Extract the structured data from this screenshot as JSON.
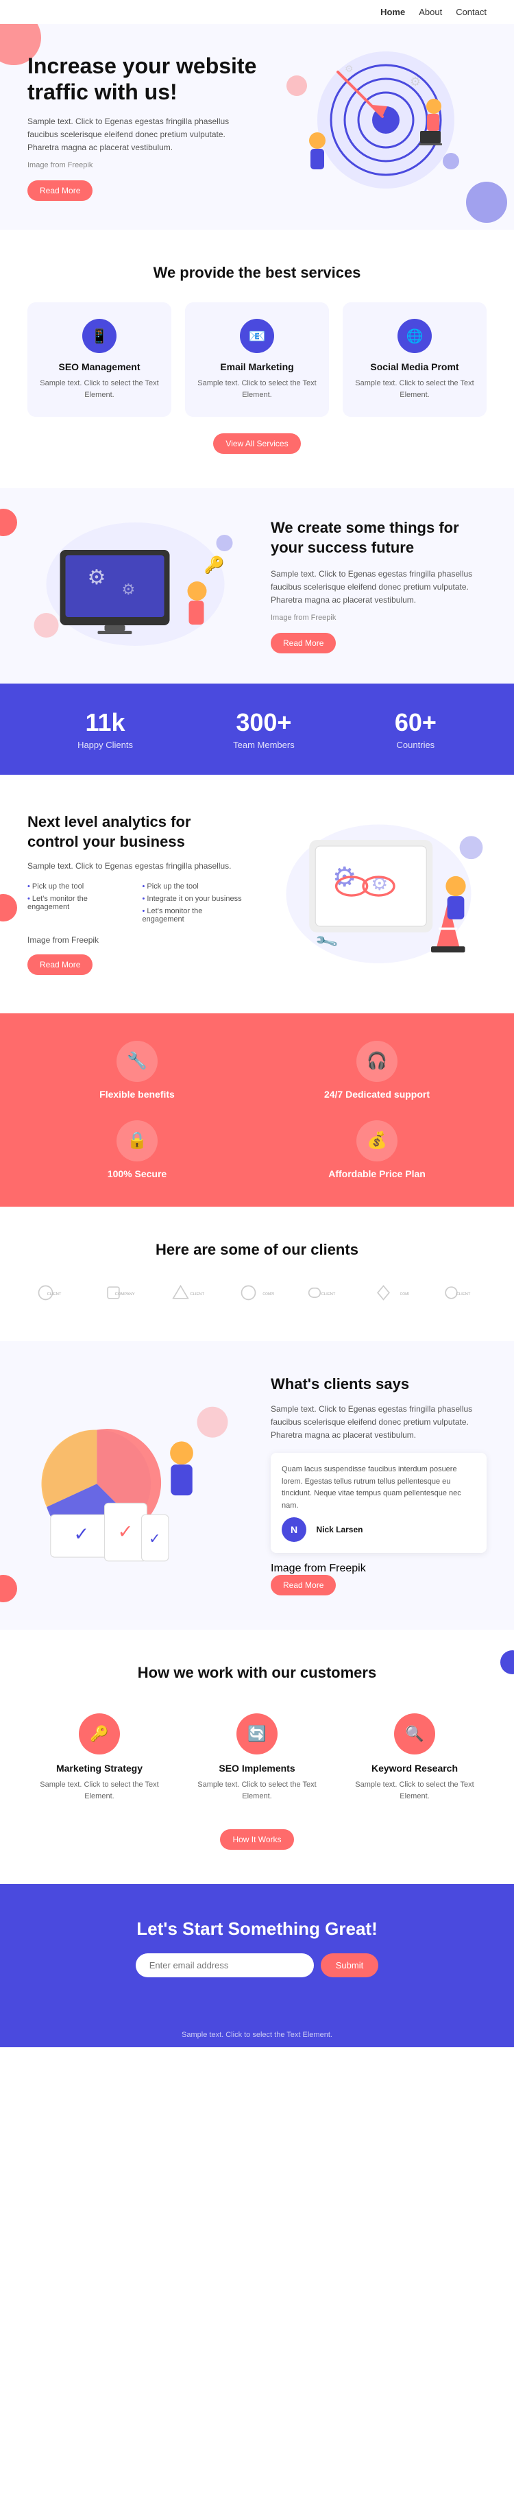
{
  "nav": {
    "links": [
      {
        "label": "Home",
        "active": true
      },
      {
        "label": "About",
        "active": false
      },
      {
        "label": "Contact",
        "active": false
      }
    ]
  },
  "hero": {
    "heading": "Increase your website traffic with us!",
    "body": "Sample text. Click to Egenas egestas fringilla phasellus faucibus scelerisque eleifend donec pretium vulputate. Pharetra magna ac placerat vestibulum.",
    "image_credit": "Image from Freepik",
    "cta_label": "Read More"
  },
  "services": {
    "heading": "We provide the best services",
    "cards": [
      {
        "icon": "📱",
        "title": "SEO Management",
        "body": "Sample text. Click to select the Text Element."
      },
      {
        "icon": "📧",
        "title": "Email Marketing",
        "body": "Sample text. Click to select the Text Element."
      },
      {
        "icon": "🌐",
        "title": "Social Media Promt",
        "body": "Sample text. Click to select the Text Element."
      }
    ],
    "view_all_label": "View All Services"
  },
  "create": {
    "heading": "We create some things for your success future",
    "body": "Sample text. Click to Egenas egestas fringilla phasellus faucibus scelerisque eleifend donec pretium vulputate. Pharetra magna ac placerat vestibulum.",
    "image_credit": "Image from Freepik",
    "cta_label": "Read More"
  },
  "stats": [
    {
      "number": "11k",
      "label": "Happy Clients"
    },
    {
      "number": "300+",
      "label": "Team Members"
    },
    {
      "number": "60+",
      "label": "Countries"
    }
  ],
  "analytics": {
    "heading": "Next level analytics for control your business",
    "body": "Sample text. Click to Egenas egestas fringilla phasellus.",
    "list_col1": [
      "Pick up the tool",
      "Let's monitor the engagement"
    ],
    "list_col2": [
      "Pick up the tool",
      "Integrate it on your business",
      "Let's monitor the engagement"
    ],
    "image_credit": "Image from Freepik",
    "cta_label": "Read More"
  },
  "features": [
    {
      "icon": "🔧",
      "label": "Flexible benefits"
    },
    {
      "icon": "🎧",
      "label": "24/7 Dedicated support"
    },
    {
      "icon": "🔒",
      "label": "100% Secure"
    },
    {
      "icon": "💰",
      "label": "Affordable Price Plan"
    }
  ],
  "clients": {
    "heading": "Here are some of our clients",
    "logos": [
      "CLIENT",
      "COMPANY",
      "CLIENT",
      "COMPANY",
      "CLIENT",
      "COMPANY",
      "CLIENT"
    ]
  },
  "testimonial": {
    "heading": "What's clients says",
    "intro": "Sample text. Click to Egenas egestas fringilla phasellus faucibus scelerisque eleifend donec pretium vulputate. Pharetra magna ac placerat vestibulum.",
    "quote": "Quam lacus suspendisse faucibus interdum posuere lorem. Egestas tellus rutrum tellus pellentesque eu tincidunt. Neque vitae tempus quam pellentesque nec nam.",
    "author": "Nick Larsen",
    "image_credit": "Image from Freepik",
    "cta_label": "Read More"
  },
  "how_we_work": {
    "heading": "How we work with our customers",
    "steps": [
      {
        "icon": "🔑",
        "title": "Marketing Strategy",
        "body": "Sample text. Click to select the Text Element."
      },
      {
        "icon": "🔄",
        "title": "SEO Implements",
        "body": "Sample text. Click to select the Text Element."
      },
      {
        "icon": "🔍",
        "title": "Keyword Research",
        "body": "Sample text. Click to select the Text Element."
      }
    ],
    "cta_label": "How It Works"
  },
  "cta": {
    "heading": "Let's Start Something Great!",
    "input_placeholder": "Enter email address",
    "submit_label": "Submit"
  },
  "footer": {
    "text": "Sample text. Click to select the Text Element."
  }
}
